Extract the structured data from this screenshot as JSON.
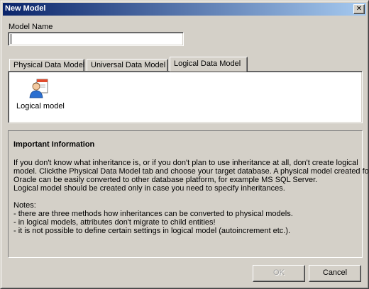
{
  "window": {
    "title": "New Model",
    "close_glyph": "✕"
  },
  "form": {
    "model_name_label": "Model Name",
    "model_name_value": "",
    "model_name_placeholder": ""
  },
  "tabs": [
    {
      "label": "Physical Data Model",
      "active": false
    },
    {
      "label": "Universal Data Model",
      "active": false
    },
    {
      "label": "Logical Data Model",
      "active": true
    }
  ],
  "model_types": [
    {
      "label": "Logical model",
      "icon": "logical-model-icon"
    }
  ],
  "info": {
    "title": "Important Information",
    "lines": [
      "If you don't know what inheritance is, or if you don't plan to use inheritance at all, don't create logical",
      "model. Clickthe Physical Data Model tab and choose your target database. A physical model created for",
      "Oracle can be easily converted to other database platform, for example MS SQL Server.",
      "Logical model should be created only in case you need to specify inheritances."
    ],
    "notes_title": "Notes:",
    "notes": [
      "- there are three methods how inheritances can be converted to physical models.",
      "- in logical models, attributes don't migrate to child entities!",
      "- it is not possible to define certain settings in logical model (autoincrement etc.)."
    ]
  },
  "buttons": {
    "ok": "OK",
    "cancel": "Cancel",
    "ok_enabled": false
  },
  "colors": {
    "face": "#d4d0c8",
    "title_start": "#0a246a",
    "title_end": "#a6caf0"
  }
}
